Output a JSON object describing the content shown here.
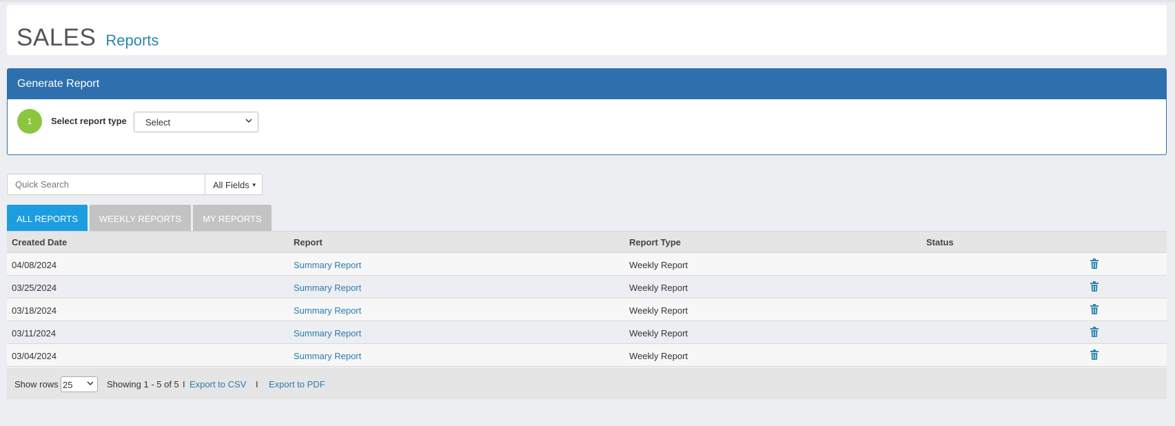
{
  "header": {
    "title": "SALES",
    "subtitle": "Reports"
  },
  "generate": {
    "panel_title": "Generate Report",
    "step_number": "1",
    "step_label": "Select report type",
    "select_value": "Select"
  },
  "search": {
    "placeholder": "Quick Search",
    "fields_label": "All Fields"
  },
  "tabs": [
    {
      "label": "ALL REPORTS",
      "active": true
    },
    {
      "label": "WEEKLY REPORTS",
      "active": false
    },
    {
      "label": "MY REPORTS",
      "active": false
    }
  ],
  "table": {
    "columns": [
      "Created Date",
      "Report",
      "Report Type",
      "Status"
    ],
    "rows": [
      {
        "date": "04/08/2024",
        "report": "Summary Report",
        "type": "Weekly Report",
        "status": ""
      },
      {
        "date": "03/25/2024",
        "report": "Summary Report",
        "type": "Weekly Report",
        "status": ""
      },
      {
        "date": "03/18/2024",
        "report": "Summary Report",
        "type": "Weekly Report",
        "status": ""
      },
      {
        "date": "03/11/2024",
        "report": "Summary Report",
        "type": "Weekly Report",
        "status": ""
      },
      {
        "date": "03/04/2024",
        "report": "Summary Report",
        "type": "Weekly Report",
        "status": ""
      }
    ]
  },
  "footer": {
    "show_rows_label": "Show rows",
    "rows_value": "25",
    "showing_text": "Showing 1 - 5 of 5",
    "separator": "I",
    "export_csv": "Export to CSV",
    "export_pdf": "Export to PDF"
  },
  "colors": {
    "accent": "#2e70ad",
    "tab_active": "#1c9de0",
    "step": "#8cc63f",
    "link": "#2a7bb0"
  },
  "icons": {
    "delete": "trash-icon",
    "dropdown": "chevron-down-icon"
  }
}
